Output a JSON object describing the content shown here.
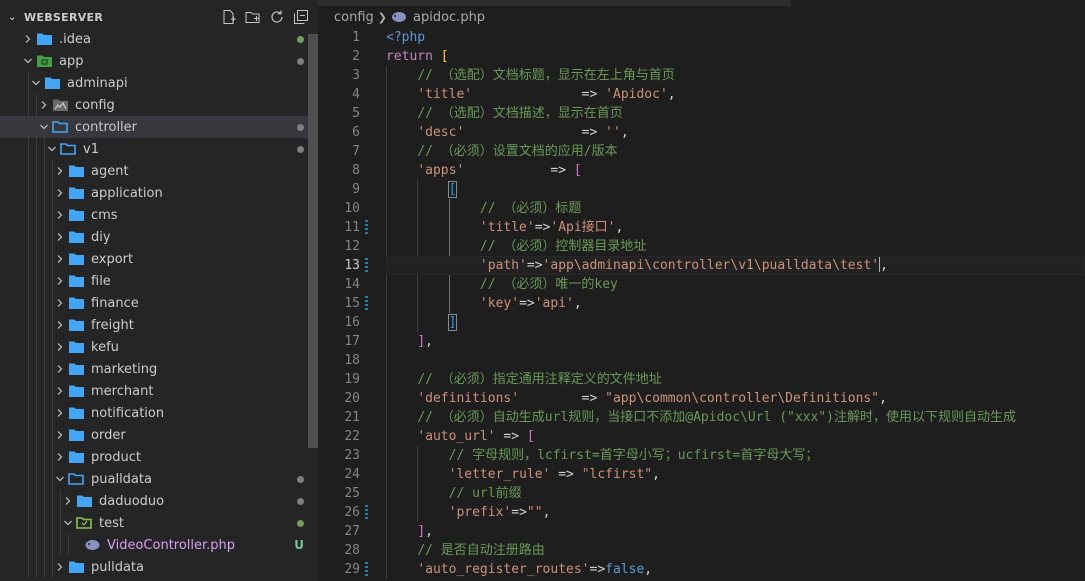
{
  "sidebar": {
    "title": "WEBSERVER",
    "actions": [
      "new-file-icon",
      "new-folder-icon",
      "refresh-icon",
      "collapse-all-icon"
    ],
    "items": [
      {
        "label": ".idea",
        "depth": 0,
        "type": "folder",
        "expanded": false,
        "badge": "dot-green"
      },
      {
        "label": "app",
        "depth": 0,
        "type": "folder-app",
        "expanded": true,
        "badge": "dot-grey"
      },
      {
        "label": "adminapi",
        "depth": 1,
        "type": "folder",
        "expanded": true,
        "badge": ""
      },
      {
        "label": "config",
        "depth": 2,
        "type": "folder-config",
        "expanded": false,
        "badge": ""
      },
      {
        "label": "controller",
        "depth": 2,
        "type": "folder-open",
        "expanded": true,
        "badge": "dot-grey",
        "selected": true
      },
      {
        "label": "v1",
        "depth": 3,
        "type": "folder-open",
        "expanded": true,
        "badge": "dot-grey"
      },
      {
        "label": "agent",
        "depth": 4,
        "type": "folder",
        "expanded": false,
        "badge": ""
      },
      {
        "label": "application",
        "depth": 4,
        "type": "folder",
        "expanded": false,
        "badge": ""
      },
      {
        "label": "cms",
        "depth": 4,
        "type": "folder",
        "expanded": false,
        "badge": ""
      },
      {
        "label": "diy",
        "depth": 4,
        "type": "folder",
        "expanded": false,
        "badge": ""
      },
      {
        "label": "export",
        "depth": 4,
        "type": "folder",
        "expanded": false,
        "badge": ""
      },
      {
        "label": "file",
        "depth": 4,
        "type": "folder",
        "expanded": false,
        "badge": ""
      },
      {
        "label": "finance",
        "depth": 4,
        "type": "folder",
        "expanded": false,
        "badge": ""
      },
      {
        "label": "freight",
        "depth": 4,
        "type": "folder",
        "expanded": false,
        "badge": ""
      },
      {
        "label": "kefu",
        "depth": 4,
        "type": "folder",
        "expanded": false,
        "badge": ""
      },
      {
        "label": "marketing",
        "depth": 4,
        "type": "folder",
        "expanded": false,
        "badge": ""
      },
      {
        "label": "merchant",
        "depth": 4,
        "type": "folder",
        "expanded": false,
        "badge": ""
      },
      {
        "label": "notification",
        "depth": 4,
        "type": "folder",
        "expanded": false,
        "badge": ""
      },
      {
        "label": "order",
        "depth": 4,
        "type": "folder",
        "expanded": false,
        "badge": ""
      },
      {
        "label": "product",
        "depth": 4,
        "type": "folder",
        "expanded": false,
        "badge": ""
      },
      {
        "label": "pualldata",
        "depth": 4,
        "type": "folder-open",
        "expanded": true,
        "badge": "dot-grey"
      },
      {
        "label": "daduoduo",
        "depth": 5,
        "type": "folder",
        "expanded": false,
        "badge": "dot-grey"
      },
      {
        "label": "test",
        "depth": 5,
        "type": "folder-test",
        "expanded": true,
        "badge": "dot-green"
      },
      {
        "label": "VideoController.php",
        "depth": 6,
        "type": "php",
        "expanded": null,
        "badge": "U"
      },
      {
        "label": "pulldata",
        "depth": 4,
        "type": "folder",
        "expanded": false,
        "badge": ""
      }
    ]
  },
  "editor": {
    "breadcrumb": [
      "config",
      "apidoc.php"
    ],
    "current_line": 13,
    "lines": [
      {
        "n": "1",
        "mod": false,
        "tokens": [
          [
            "tg",
            "<?php"
          ]
        ]
      },
      {
        "n": "2",
        "mod": false,
        "tokens": [
          [
            "kw",
            "return"
          ],
          [
            "op",
            " "
          ],
          [
            "br1",
            "["
          ]
        ]
      },
      {
        "n": "3",
        "mod": false,
        "tokens": [
          [
            "op",
            "    "
          ],
          [
            "cm",
            "// （选配）文档标题，显示在左上角与首页"
          ]
        ]
      },
      {
        "n": "4",
        "mod": false,
        "tokens": [
          [
            "op",
            "    "
          ],
          [
            "st",
            "'title'"
          ],
          [
            "op",
            "              => "
          ],
          [
            "st",
            "'Apidoc'"
          ],
          [
            "op",
            ","
          ]
        ]
      },
      {
        "n": "5",
        "mod": false,
        "tokens": [
          [
            "op",
            "    "
          ],
          [
            "cm",
            "// （选配）文档描述，显示在首页"
          ]
        ]
      },
      {
        "n": "6",
        "mod": false,
        "tokens": [
          [
            "op",
            "    "
          ],
          [
            "st",
            "'desc'"
          ],
          [
            "op",
            "               => "
          ],
          [
            "st",
            "''"
          ],
          [
            "op",
            ","
          ]
        ]
      },
      {
        "n": "7",
        "mod": false,
        "tokens": [
          [
            "op",
            "    "
          ],
          [
            "cm",
            "// （必须）设置文档的应用/版本"
          ]
        ]
      },
      {
        "n": "8",
        "mod": false,
        "tokens": [
          [
            "op",
            "    "
          ],
          [
            "st",
            "'apps'"
          ],
          [
            "op",
            "           => "
          ],
          [
            "br2",
            "["
          ]
        ]
      },
      {
        "n": "9",
        "mod": false,
        "tokens": [
          [
            "op",
            "        "
          ],
          [
            "br3b",
            "["
          ]
        ]
      },
      {
        "n": "10",
        "mod": false,
        "tokens": [
          [
            "op",
            "            "
          ],
          [
            "cm",
            "// （必须）标题"
          ]
        ]
      },
      {
        "n": "11",
        "mod": true,
        "tokens": [
          [
            "op",
            "            "
          ],
          [
            "st",
            "'title'"
          ],
          [
            "op",
            "=>"
          ],
          [
            "st",
            "'Api接口'"
          ],
          [
            "op",
            ","
          ]
        ]
      },
      {
        "n": "12",
        "mod": false,
        "tokens": [
          [
            "op",
            "            "
          ],
          [
            "cm",
            "// （必须）控制器目录地址"
          ]
        ]
      },
      {
        "n": "13",
        "mod": true,
        "tokens": [
          [
            "op",
            "            "
          ],
          [
            "st",
            "'path'"
          ],
          [
            "op",
            "=>"
          ],
          [
            "st",
            "'app\\adminapi\\controller\\v1\\pualldata\\test'"
          ],
          [
            "cur",
            ""
          ],
          [
            "op",
            ","
          ]
        ]
      },
      {
        "n": "14",
        "mod": false,
        "tokens": [
          [
            "op",
            "            "
          ],
          [
            "cm",
            "// （必须）唯一的key"
          ]
        ]
      },
      {
        "n": "15",
        "mod": true,
        "tokens": [
          [
            "op",
            "            "
          ],
          [
            "st",
            "'key'"
          ],
          [
            "op",
            "=>"
          ],
          [
            "st",
            "'api'"
          ],
          [
            "op",
            ","
          ]
        ]
      },
      {
        "n": "16",
        "mod": false,
        "tokens": [
          [
            "op",
            "        "
          ],
          [
            "br3b",
            "]"
          ]
        ]
      },
      {
        "n": "17",
        "mod": false,
        "tokens": [
          [
            "op",
            "    "
          ],
          [
            "br2",
            "]"
          ],
          [
            "op",
            ","
          ]
        ]
      },
      {
        "n": "18",
        "mod": false,
        "tokens": [
          [
            "op",
            ""
          ]
        ]
      },
      {
        "n": "19",
        "mod": false,
        "tokens": [
          [
            "op",
            "    "
          ],
          [
            "cm",
            "// （必须）指定通用注释定义的文件地址"
          ]
        ]
      },
      {
        "n": "20",
        "mod": false,
        "tokens": [
          [
            "op",
            "    "
          ],
          [
            "st",
            "'definitions'"
          ],
          [
            "op",
            "        => "
          ],
          [
            "st",
            "\"app\\common\\controller\\Definitions\""
          ],
          [
            "op",
            ","
          ]
        ]
      },
      {
        "n": "21",
        "mod": false,
        "tokens": [
          [
            "op",
            "    "
          ],
          [
            "cm",
            "// （必须）自动生成url规则，当接口不添加@Apidoc\\Url (\"xxx\")注解时，使用以下规则自动生成"
          ]
        ]
      },
      {
        "n": "22",
        "mod": false,
        "tokens": [
          [
            "op",
            "    "
          ],
          [
            "st",
            "'auto_url'"
          ],
          [
            "op",
            " => "
          ],
          [
            "br2",
            "["
          ]
        ]
      },
      {
        "n": "23",
        "mod": false,
        "tokens": [
          [
            "op",
            "        "
          ],
          [
            "cm",
            "// 字母规则，lcfirst=首字母小写；ucfirst=首字母大写；"
          ]
        ]
      },
      {
        "n": "24",
        "mod": false,
        "tokens": [
          [
            "op",
            "        "
          ],
          [
            "st",
            "'letter_rule'"
          ],
          [
            "op",
            " => "
          ],
          [
            "st",
            "\"lcfirst\""
          ],
          [
            "op",
            ","
          ]
        ]
      },
      {
        "n": "25",
        "mod": false,
        "tokens": [
          [
            "op",
            "        "
          ],
          [
            "cm",
            "// url前缀"
          ]
        ]
      },
      {
        "n": "26",
        "mod": true,
        "tokens": [
          [
            "op",
            "        "
          ],
          [
            "st",
            "'prefix'"
          ],
          [
            "op",
            "=>"
          ],
          [
            "st",
            "\"\""
          ],
          [
            "op",
            ","
          ]
        ]
      },
      {
        "n": "27",
        "mod": false,
        "tokens": [
          [
            "op",
            "    "
          ],
          [
            "br2",
            "]"
          ],
          [
            "op",
            ","
          ]
        ]
      },
      {
        "n": "28",
        "mod": false,
        "tokens": [
          [
            "op",
            "    "
          ],
          [
            "cm",
            "// 是否自动注册路由"
          ]
        ]
      },
      {
        "n": "29",
        "mod": true,
        "tokens": [
          [
            "op",
            "    "
          ],
          [
            "st",
            "'auto_register_routes'"
          ],
          [
            "op",
            "=>"
          ],
          [
            "bl",
            "false"
          ],
          [
            "op",
            ","
          ]
        ]
      }
    ]
  },
  "colors": {
    "folder": "#42a5f5",
    "folder_app": "#43a047",
    "php": "#8892bf",
    "accent": "#007acc"
  }
}
